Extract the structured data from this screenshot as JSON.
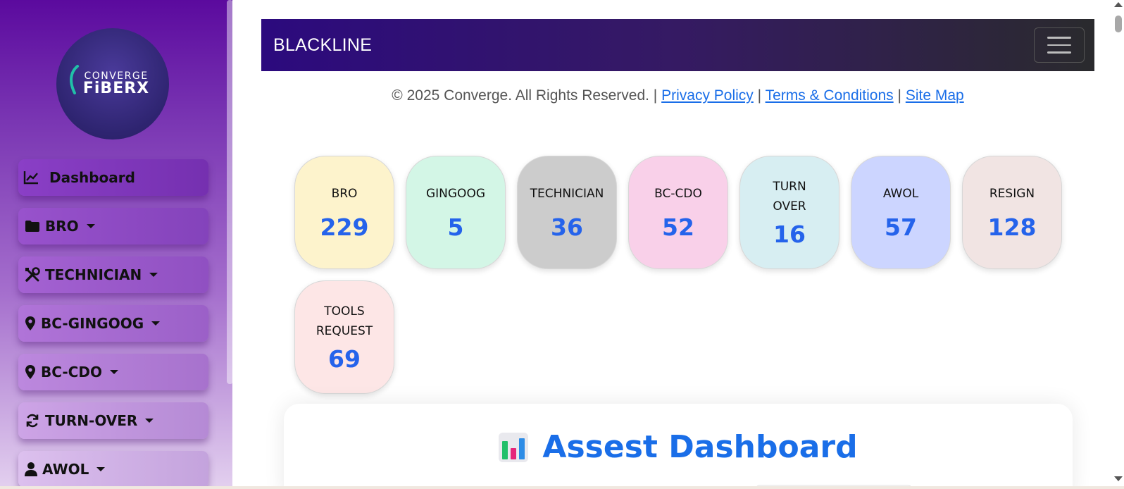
{
  "sidebar": {
    "logo": {
      "top_text": "CONVERGE",
      "bottom_text": "FiBERX"
    },
    "items": [
      {
        "label": "Dashboard",
        "icon": "chart-line-icon",
        "has_caret": false
      },
      {
        "label": "BRO",
        "icon": "folder-icon",
        "has_caret": true
      },
      {
        "label": "TECHNICIAN",
        "icon": "tools-icon",
        "has_caret": true
      },
      {
        "label": "BC-GINGOOG",
        "icon": "map-pin-icon",
        "has_caret": true
      },
      {
        "label": "BC-CDO",
        "icon": "map-pin-icon",
        "has_caret": true
      },
      {
        "label": "TURN-OVER",
        "icon": "sync-icon",
        "has_caret": true
      },
      {
        "label": "AWOL",
        "icon": "user-icon",
        "has_caret": true
      }
    ]
  },
  "header": {
    "brand": "BLACKLINE",
    "toggler_icon": "hamburger-menu-icon"
  },
  "footer": {
    "copyright": "© 2025 Converge. All Rights Reserved. |",
    "sep": "|",
    "links": [
      "Privacy Policy",
      "Terms & Conditions",
      "Site Map"
    ]
  },
  "cards": [
    {
      "label": "BRO",
      "value": "229",
      "bg": "#fdf3cc"
    },
    {
      "label": "GINGOOG",
      "value": "5",
      "bg": "#d3f6e6"
    },
    {
      "label": "TECHNICIAN",
      "value": "36",
      "bg": "#cccccc"
    },
    {
      "label": "BC-CDO",
      "value": "52",
      "bg": "#f9d0e9"
    },
    {
      "label": "TURN OVER",
      "value": "16",
      "bg": "#d7eef2"
    },
    {
      "label": "AWOL",
      "value": "57",
      "bg": "#ccd5ff"
    },
    {
      "label": "RESIGN",
      "value": "128",
      "bg": "#f1e4e3"
    },
    {
      "label": "TOOLS REQUEST",
      "value": "69",
      "bg": "#fde6e6"
    }
  ],
  "asset": {
    "title": "Assest Dashboard",
    "icon": "bar-chart-icon"
  },
  "colors": {
    "accent": "#1a6ee8",
    "value_blue": "#2563eb",
    "topbar_start": "#2c0a7e",
    "sidebar_top": "#5b0a9e"
  }
}
